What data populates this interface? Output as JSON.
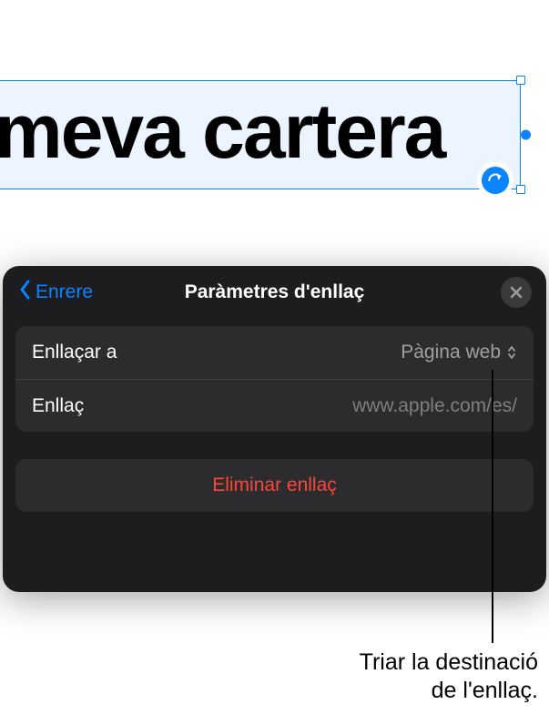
{
  "canvas": {
    "linked_text": "meva cartera"
  },
  "popover": {
    "back_label": "Enrere",
    "title": "Paràmetres d'enllaç",
    "link_to_label": "Enllaçar a",
    "link_to_value": "Pàgina web",
    "link_label": "Enllaç",
    "link_placeholder": "www.apple.com/es/",
    "delete_label": "Eliminar enllaç"
  },
  "annotation": {
    "line1": "Triar la destinació",
    "line2": "de l'enllaç."
  },
  "icons": {
    "back": "chevron-left-icon",
    "close": "close-icon",
    "linkbadge": "share-arrow-icon",
    "updown": "chevron-up-down-icon"
  }
}
